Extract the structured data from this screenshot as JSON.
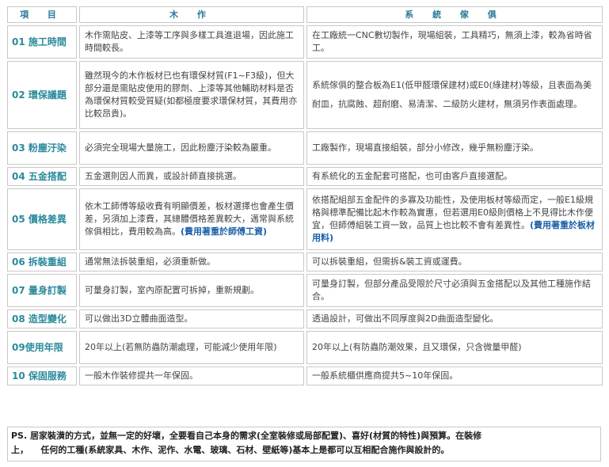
{
  "header": {
    "item": "項 目",
    "woodwork": "木 作",
    "system": "系 統 傢 俱"
  },
  "rows": [
    {
      "label": "01 施工時間",
      "woodwork": "木作需貼皮、上漆等工序與多樣工具進退場，因此施工時間較長。",
      "system": "在工廠統一CNC數切製作，現場組裝，工具精巧，無須上漆，較為省時省工。"
    },
    {
      "label": "02 環保議題",
      "woodwork": "雖然現今的木作板材已也有環保材質(F1~F3級)，但大部分還是需貼皮使用的膠劑、上漆等其他輔助材料是否為環保材質較受質疑(如都極度要求環保材質，其費用亦比較昂貴)。",
      "system": "系統傢俱的整合板為E1(低甲醛環保建材)或E0(綠建材)等級，且表面為美耐皿，抗腐蝕、超耐磨、易清潔、二級防火建材，無須另作表面處理。"
    },
    {
      "label": "03 粉塵汙染",
      "woodwork": "必須完全現場大量施工，因此粉塵汙染較為嚴重。",
      "system": "工廠製作，現場直接組裝，部分小修改，幾乎無粉塵汙染。"
    },
    {
      "label": "04 五金搭配",
      "woodwork": "五金選則因人而異，或設計師直接挑選。",
      "system": "有系統化的五金配套可搭配，也可由客戶直接選配。"
    },
    {
      "label": "05 價格差異",
      "woodwork": "依木工師傅等級收費有明顯價差，板材選擇也會產生價差，另須加上漆費，其總體價格差異較大，邁常與系統傢俱相比，費用較為高。",
      "woodwork_note": "(費用著重於師傅工資)",
      "system": "依搭配組部五金配件的多寡及功能性，及使用板材等級而定，一般E1級規格與標準配備比起木作較為實惠，但若選用E0級則價格上不見得比木作便宜，但師傅組裝工資一致，品質上也比較不會有差異性。",
      "system_note": "(費用著重於板材用料)"
    },
    {
      "label": "06 拆裝重組",
      "woodwork": "通常無法拆裝重組，必須重新做。",
      "system": "可以拆裝重組，但需拆&裝工資或運費。"
    },
    {
      "label": "07 量身訂製",
      "woodwork": "可量身訂製，室內原配置可拆掉，重新規劃。",
      "system": "可量身訂製，但部分產品受限於尺寸必須與五金搭配以及其他工種施作結合。"
    },
    {
      "label": "08 造型變化",
      "woodwork": "可以做出3D立體曲面造型。",
      "system": "透過設計，可做出不同厚度與2D曲面造型變化。"
    },
    {
      "label": "09使用年限",
      "woodwork": "20年以上(若無防蟲防潮處理，可能減少使用年限)",
      "system": "20年以上(有防蟲防潮效果，且又環保，只含微量甲醛)"
    },
    {
      "label": "10 保固服務",
      "woodwork": "一般木作裝修提共一年保固。",
      "system": "一般系統櫃供應商提共5~10年保固。"
    }
  ],
  "footer": {
    "ps_line1": "PS. 居家裝潢的方式，並無一定的好壞，全要看自己本身的需求(全室裝修或局部配置)、喜好(材質的特性)與預算。在裝修",
    "ps_line2": "上，    任何的工種(系統家具、木作、泥作、水電、玻璃、石材、壁紙等)基本上是都可以互相配合施作與設計的。"
  }
}
